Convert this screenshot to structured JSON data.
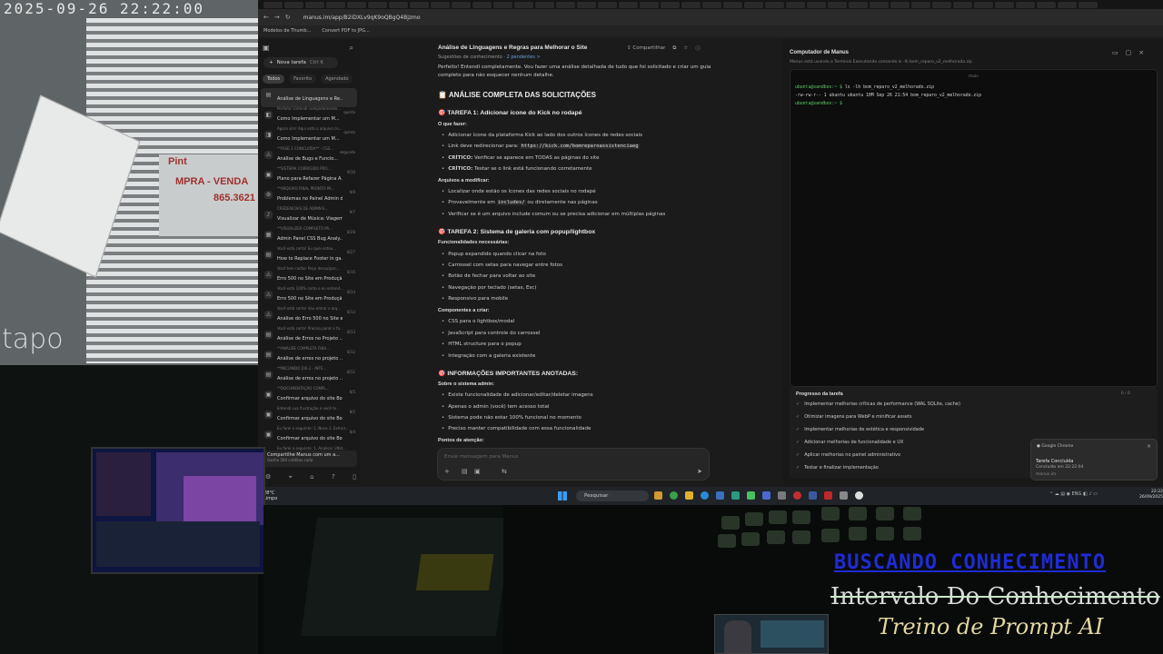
{
  "camera": {
    "timestamp": "2025-09-26  22:22:00",
    "brand": "tapo",
    "sign_line1": "Pint",
    "sign_line2": "MPRA - VENDA",
    "sign_line3": "865.3621"
  },
  "browser": {
    "url": "manus.im/app/B2iDXLv9qK9oQBgQ4Bjzmo",
    "nav": [
      "←",
      "→",
      "↻"
    ],
    "bookmarks": [
      "Modelos de Thumb...",
      "Convert PDF to JPG..."
    ]
  },
  "sidebar": {
    "new_task": "Nova tarefa",
    "shortcut": "Ctrl K",
    "filters": [
      "Todos",
      "Favorito",
      "Agendado"
    ],
    "tasks": [
      {
        "title": "Análise de Linguagens e Re...",
        "sub": "Perfeito! Entendi completamente...",
        "date": ""
      },
      {
        "title": "Como Implementar um M...",
        "sub": "Agora sim! Aqui está o arquivo co...",
        "date": "quinta"
      },
      {
        "title": "Como Implementar um M...",
        "sub": "**FASE 1 CONCLUÍDA** - CSS...",
        "date": "quinta"
      },
      {
        "title": "Análise de Bugs e Funcio...",
        "sub": "**SISTEMA CORRIGIDO PRO...",
        "date": "segunda"
      },
      {
        "title": "Plano para Refazer Página A...",
        "sub": "**ARQUIVO FINAL PRONTO PA...",
        "date": "9/10"
      },
      {
        "title": "Problemas no Painel Admin d...",
        "sub": "CREDENCIAIS DE ADMIN E...",
        "date": "9/9"
      },
      {
        "title": "Visualizar de Música: Viagem...",
        "sub": "**VISUALIZER COMPLETO PA...",
        "date": "9/7"
      },
      {
        "title": "Admin Panel CSS Bug Analy...",
        "sub": "Você está certo! Eu quei estou...",
        "date": "8/28"
      },
      {
        "title": "How to Replace Footer in ga...",
        "sub": "Você tem razão! Peço desculpas...",
        "date": "8/27"
      },
      {
        "title": "Erro 500 no Site em Produçã...",
        "sub": "Você está 100% certo e eu entend...",
        "date": "8/15"
      },
      {
        "title": "Erro 500 no Site em Produçã...",
        "sub": "Você está certo! Vou entrar o arq...",
        "date": "8/14"
      },
      {
        "title": "Análise do Erro 500 no Site e...",
        "sub": "Você está certo! Preciso parar e fa...",
        "date": "8/13"
      },
      {
        "title": "Análise de Erros no Projeto ...",
        "sub": "**ANÁLISE COMPLETA FINA...",
        "date": "8/13"
      },
      {
        "title": "Análise de erros no projeto ...",
        "sub": "**INICIANDO DIA 2 - INTE...",
        "date": "8/12"
      },
      {
        "title": "Análise de erros no projeto ...",
        "sub": "**DOCUMENTAÇÃO COMPL...",
        "date": "8/11"
      },
      {
        "title": "Confirmar arquivo do site Bo...",
        "sub": "Entendi sua frustração e você te...",
        "date": "8/5"
      },
      {
        "title": "Confirmar arquivo do site Bo...",
        "sub": "Eu farei o seguinte: 1. Nova 1. Extrair...",
        "date": "8/5"
      },
      {
        "title": "Confirmar arquivo do site Bo...",
        "sub": "Eu farei o seguinte: 1. Analisar Ultid...",
        "date": "8/4"
      }
    ],
    "share_title": "Compartilhe Manus com um a...",
    "share_sub": "Ganhe 500 créditos cada"
  },
  "chat": {
    "title": "Análise de Linguagens e Regras para Melhorar o Site",
    "share": "Compartilhar",
    "suggested": "Sugestões de conhecimento",
    "pending": "2 pendentes >",
    "intro1": "Perfeito! Entendi completamente. Vou fazer uma análise detalhada de tudo que foi solicitado e criar um guia",
    "intro2": "completo para não esquecer nenhum detalhe.",
    "h_main": "📋 ANÁLISE COMPLETA DAS SOLICITAÇÕES",
    "t1": "🎯 TAREFA 1: Adicionar ícone do Kick no rodapé",
    "o_que_fazer": "O que fazer:",
    "t1_items": [
      "Adicionar ícone da plataforma Kick ao lado dos outros ícones de redes sociais"
    ],
    "link_label": "Link deve redirecionar para: ",
    "link_url": "https://kick.com/bomreparoassistenciaeg",
    "critico1_b": "CRÍTICO:",
    "critico1": " Verificar se aparece em TODAS as páginas do site",
    "critico2_b": "CRÍTICO:",
    "critico2": " Testar se o link está funcionando corretamente",
    "arquivos": "Arquivos a modificar:",
    "arq_items": [
      "Localizar onde estão os ícones das redes sociais no rodapé"
    ],
    "prov_a": "Provavelmente em ",
    "prov_code": "includes/",
    "prov_b": " ou diretamente nas páginas",
    "arq3": "Verificar se é um arquivo include comum ou se precisa adicionar em múltiplas páginas",
    "t2": "🎯 TAREFA 2: Sistema de galeria com popup/lightbox",
    "func": "Funcionalidades necessárias:",
    "func_items": [
      "Popup expandido quando clicar na foto",
      "Carrossel com setas para navegar entre fotos",
      "Botão de fechar para voltar ao site",
      "Navegação por teclado (setas, Esc)",
      "Responsivo para mobile"
    ],
    "comp": "Componentes a criar:",
    "comp_items": [
      "CSS para o lightbox/modal",
      "JavaScript para controle do carrossel",
      "HTML structure para o popup",
      "Integração com a galeria existente"
    ],
    "t3": "🎯 INFORMAÇÕES IMPORTANTES ANOTADAS:",
    "sobre": "Sobre o sistema admin:",
    "sobre_items": [
      "Existe funcionalidade de adicionar/editar/deletar imagens",
      "Apenas o admin (você) tem acesso total",
      "Sistema pode não estar 100% funcional no momento",
      "Preciso manter compatibilidade com essa funcionalidade"
    ],
    "pontos": "Pontos de atenção:",
    "input_placeholder": "Envie mensagem para Manus"
  },
  "computer": {
    "title": "Computador de Manus",
    "sub": "Manus está usando o Terminal    Executando comando  ls -lh bom_reparo_v2_melhorado.zip",
    "term_header": "main",
    "lines": [
      {
        "prompt": "ubuntu@sandbox:~ $",
        "cmd": " ls -lh bom_reparo_v2_melhorado.zip"
      },
      {
        "prompt": "",
        "cmd": "-rw-rw-r-- 1 ubuntu ubuntu 10M Sep 26 21:54 bom_reparo_v2_melhorado.zip"
      },
      {
        "prompt": "ubuntu@sandbox:~ $",
        "cmd": ""
      }
    ],
    "progress_title": "Progresso da tarefa",
    "progress_count": "6 / 6",
    "steps": [
      "Implementar melhorias críticas de performance (WAL SQLite, cache)",
      "Otimizar imagens para WebP e minificar assets",
      "Implementar melhorias de estética e responsividade",
      "Adicionar melhorias de funcionalidade e UX",
      "Aplicar melhorias no painel administrativo",
      "Testar e finalizar implementação"
    ]
  },
  "notification": {
    "app": "Google Chrome",
    "title": "Tarefa Concluída",
    "body": "Concluído em 22:22:04",
    "source": "manus.im"
  },
  "taskbar": {
    "temp": "28°C",
    "weather": "Limpo",
    "search": "Pesquisar",
    "time": "22:22",
    "date": "26/09/2025",
    "lang": "ENG"
  },
  "overlay": {
    "line1": "BUSCANDO CONHECIMENTO",
    "line2": "Intervalo Do Conhecimento",
    "line3": "Treino de Prompt AI"
  }
}
